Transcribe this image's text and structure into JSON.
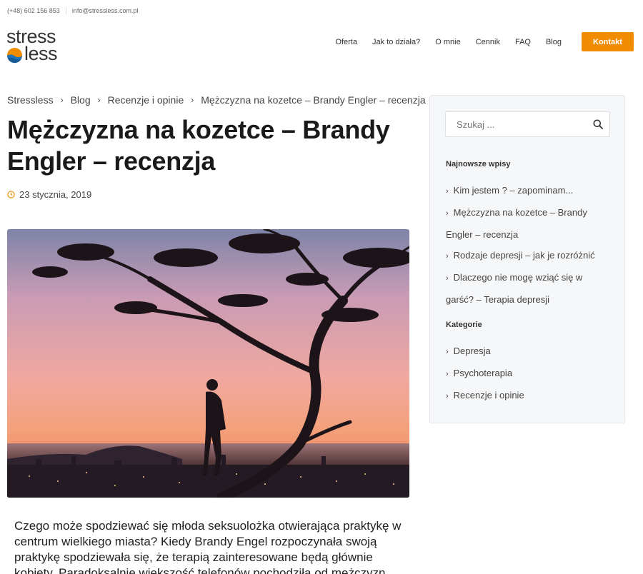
{
  "topbar": {
    "phone": "(+48) 602 156 853",
    "email": "info@stressless.com.pl"
  },
  "logo": {
    "line1": "stress",
    "line2": "less"
  },
  "nav": {
    "items": [
      "Oferta",
      "Jak to działa?",
      "O mnie",
      "Cennik",
      "FAQ",
      "Blog"
    ],
    "cta": "Kontakt"
  },
  "breadcrumb": [
    "Stressless",
    "Blog",
    "Recenzje i opinie",
    "Mężczyzna na kozetce – Brandy Engler – recenzja"
  ],
  "post": {
    "title": "Mężczyzna na kozetce – Brandy Engler – recenzja",
    "date": "23 stycznia, 2019",
    "excerpt": "Czego może spodziewać się młoda seksuolożka otwierająca praktykę w centrum wielkiego miasta? Kiedy Brandy Engel rozpoczynała swoją praktykę spodziewała się, że terapią zainteresowane będą głównie kobiety. Paradoksalnie większość telefonów pochodziła od mężczyzn"
  },
  "sidebar": {
    "search": {
      "placeholder": "Szukaj ..."
    },
    "recent": {
      "title": "Najnowsze wpisy",
      "items": [
        "Kim jestem ? – zapominam...",
        "Mężczyzna na kozetce – Brandy Engler – recenzja",
        "Rodzaje depresji – jak je rozróżnić",
        "Dlaczego nie mogę wziąć się w garść? – Terapia depresji"
      ]
    },
    "categories": {
      "title": "Kategorie",
      "items": [
        "Depresja",
        "Psychoterapia",
        "Recenzje i opinie"
      ]
    }
  },
  "colors": {
    "accent": "#f08c00",
    "logo_blue": "#1e73be",
    "logo_orange": "#f08c00"
  }
}
